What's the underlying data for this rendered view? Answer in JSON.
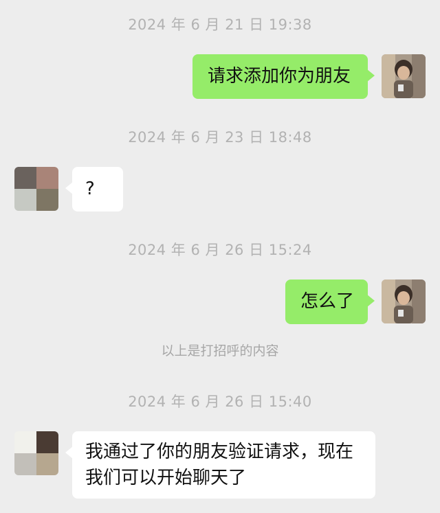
{
  "chat": {
    "timestamps": [
      "2024 年 6 月 21 日 19:38",
      "2024 年 6 月 23 日 18:48",
      "2024 年 6 月 26 日 15:24",
      "2024 年 6 月 26 日 15:40"
    ],
    "messages": [
      {
        "sender": "me",
        "text": "请求添加你为朋友"
      },
      {
        "sender": "other",
        "text": "?"
      },
      {
        "sender": "me",
        "text": "怎么了"
      },
      {
        "sender": "other",
        "text": "我通过了你的朋友验证请求，现在我们可以开始聊天了"
      }
    ],
    "system_note": "以上是打招呼的内容"
  },
  "colors": {
    "background": "#ededed",
    "sent_bubble": "#95ec69",
    "received_bubble": "#ffffff",
    "timestamp_text": "#b2b2b2"
  }
}
